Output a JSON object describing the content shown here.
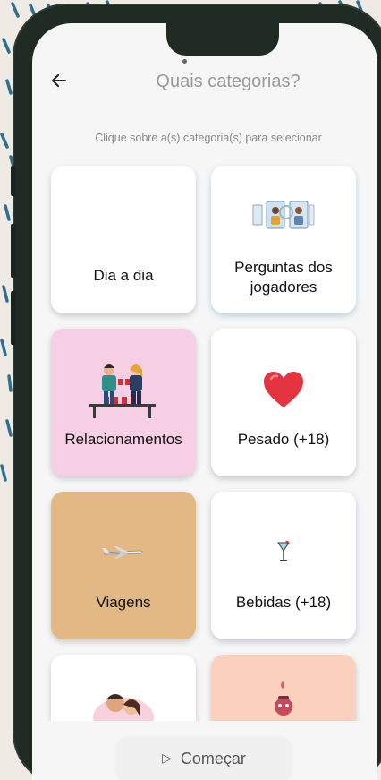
{
  "header": {
    "back_icon": "arrow-left-icon",
    "title": "Quais categorias?"
  },
  "subtitle": "Clique sobre a(s) categoria(s) para selecionar",
  "categories": [
    {
      "label": "Dia a dia",
      "bg": "#ffffff",
      "icon": "none"
    },
    {
      "label": "Perguntas dos jogadores",
      "line1": "Perguntas dos",
      "line2": "jogadores",
      "bg": "#ffffff",
      "icon": "player-profiles-icon"
    },
    {
      "label": "Relacionamentos",
      "bg": "#f6cfe4",
      "icon": "couple-drinks-icon"
    },
    {
      "label": "Pesado (+18)",
      "bg": "#ffffff",
      "icon": "heart-icon"
    },
    {
      "label": "Viagens",
      "bg": "#e2b885",
      "icon": "airplane-icon"
    },
    {
      "label": "Bebidas (+18)",
      "bg": "#ffffff",
      "icon": "cocktail-icon"
    },
    {
      "label": "",
      "bg": "#ffffff",
      "icon": "hugging-couple-icon"
    },
    {
      "label": "",
      "bg": "#fbd0bc",
      "icon": "cartoon-character-icon"
    }
  ],
  "footer": {
    "start_label": "Começar",
    "start_icon": "play-icon"
  },
  "colors": {
    "background": "#efebe4",
    "phone_frame": "#1f2b23",
    "screen": "#f6f6f6",
    "dash_accent": "#2e6f8f"
  }
}
